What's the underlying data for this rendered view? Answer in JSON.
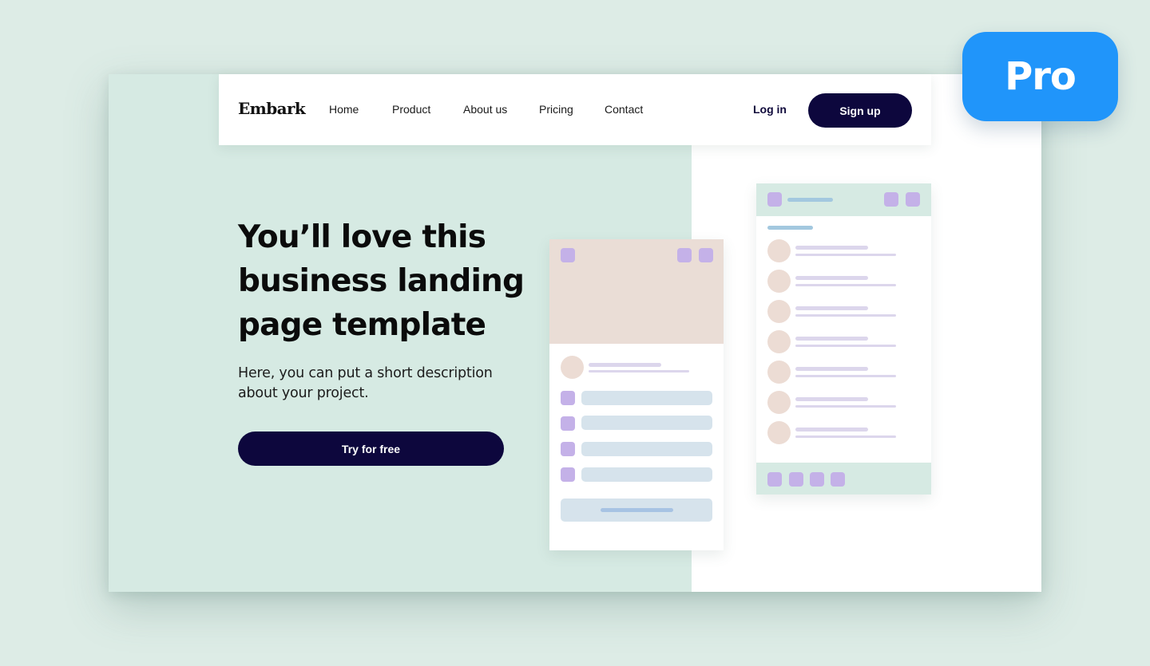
{
  "badge": {
    "label": "Pro",
    "color": "#2095fa"
  },
  "nav": {
    "logo": "Embark",
    "links": [
      {
        "label": "Home"
      },
      {
        "label": "Product"
      },
      {
        "label": "About us"
      },
      {
        "label": "Pricing"
      },
      {
        "label": "Contact"
      }
    ],
    "login_label": "Log in",
    "signup_label": "Sign up"
  },
  "hero": {
    "title": "You’ll love this business landing page template",
    "description": "Here, you can put a short description about your project.",
    "cta_label": "Try for free"
  },
  "colors": {
    "primary_dark": "#0d073d",
    "mint_background": "#d6eae3",
    "page_background": "#ddece6",
    "placeholder_purple": "#c4b1e8",
    "placeholder_peach": "#eaddd6",
    "placeholder_blue": "#d6e3ec"
  },
  "mock_cards": {
    "left_card": {
      "list_rows": 4,
      "has_header_image": true,
      "has_button": true
    },
    "right_card": {
      "list_rows": 7,
      "footer_icons": 4,
      "header_icons": 3
    }
  }
}
